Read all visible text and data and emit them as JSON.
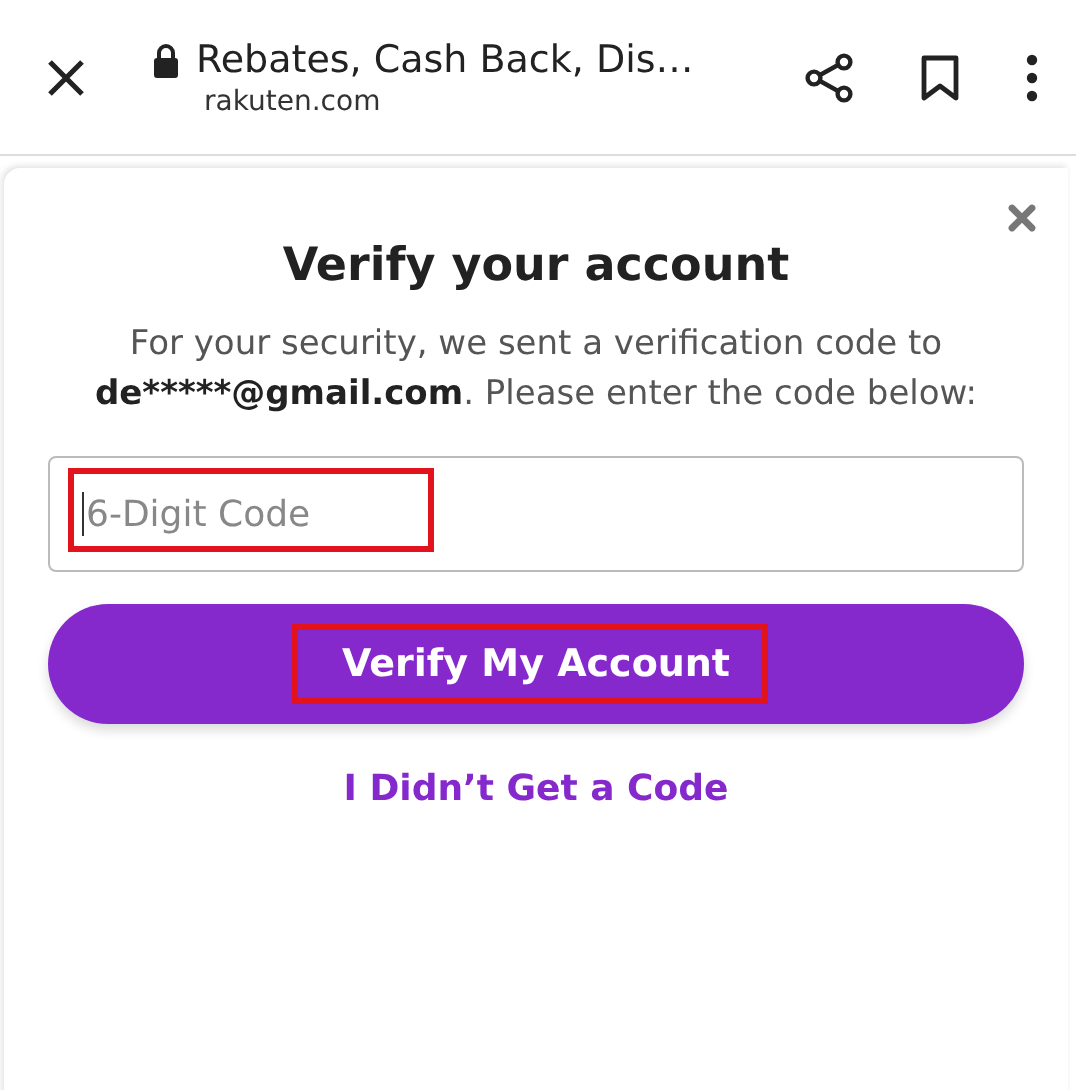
{
  "browser_bar": {
    "page_title": "Rebates, Cash Back, Dis…",
    "url": "rakuten.com",
    "secure": true
  },
  "dialog": {
    "title": "Verify your account",
    "message": {
      "before": "For your security, we sent a verification code to",
      "email": "de*****@gmail.com",
      "after": ". Please enter the code below:"
    },
    "code_field": {
      "placeholder": "6-Digit Code",
      "focused": true,
      "highlighted": true
    },
    "verify_button": {
      "label": "Verify My Account",
      "highlighted": true
    },
    "resend_link": "I Didn’t Get a Code"
  }
}
